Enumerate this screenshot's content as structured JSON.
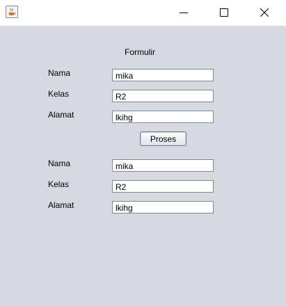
{
  "window": {
    "app_icon": "java-cup-icon",
    "controls": [
      "minimize-icon",
      "maximize-icon",
      "close-icon"
    ]
  },
  "form": {
    "title": "Formulir",
    "input": {
      "nama_label": "Nama",
      "nama_value": "mika",
      "kelas_label": "Kelas",
      "kelas_value": "R2",
      "alamat_label": "Alamat",
      "alamat_value": "lkihg"
    },
    "proses_label": "Proses",
    "output": {
      "nama_label": "Nama",
      "nama_value": "mika",
      "kelas_label": "Kelas",
      "kelas_value": "R2",
      "alamat_label": "Alamat",
      "alamat_value": "lkihg"
    }
  },
  "colors": {
    "background": "#d6d9df",
    "titlebar": "#ffffff",
    "field_border": "#7a8a99"
  }
}
